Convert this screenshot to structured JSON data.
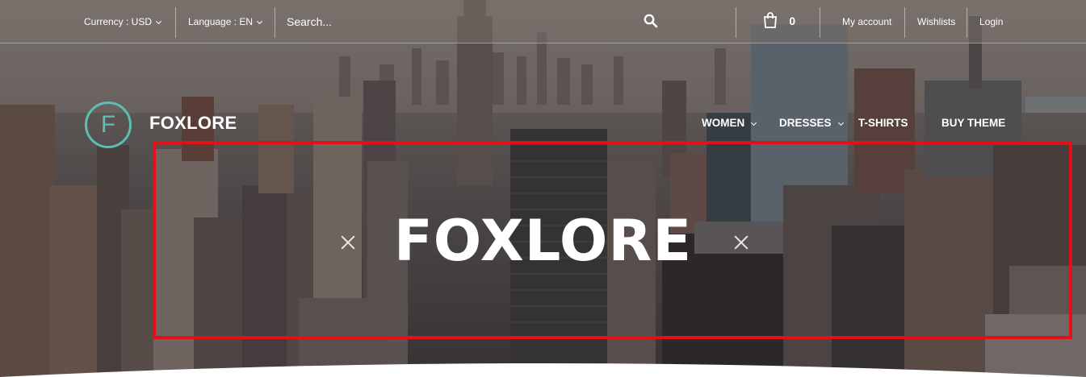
{
  "topbar": {
    "currency_label": "Currency : USD",
    "language_label": "Language : EN",
    "search_placeholder": "Search...",
    "cart_count": "0",
    "links": [
      "My account",
      "Wishlists",
      "Login"
    ]
  },
  "header": {
    "logo_letter": "F",
    "brand_name": "FOXLORE",
    "nav": [
      "WOMEN",
      "DRESSES",
      "T-SHIRTS",
      "BUY THEME"
    ]
  },
  "hero": {
    "title": "FOXLORE"
  },
  "colors": {
    "accent": "#5fbdb2",
    "highlight": "#e3101a"
  }
}
